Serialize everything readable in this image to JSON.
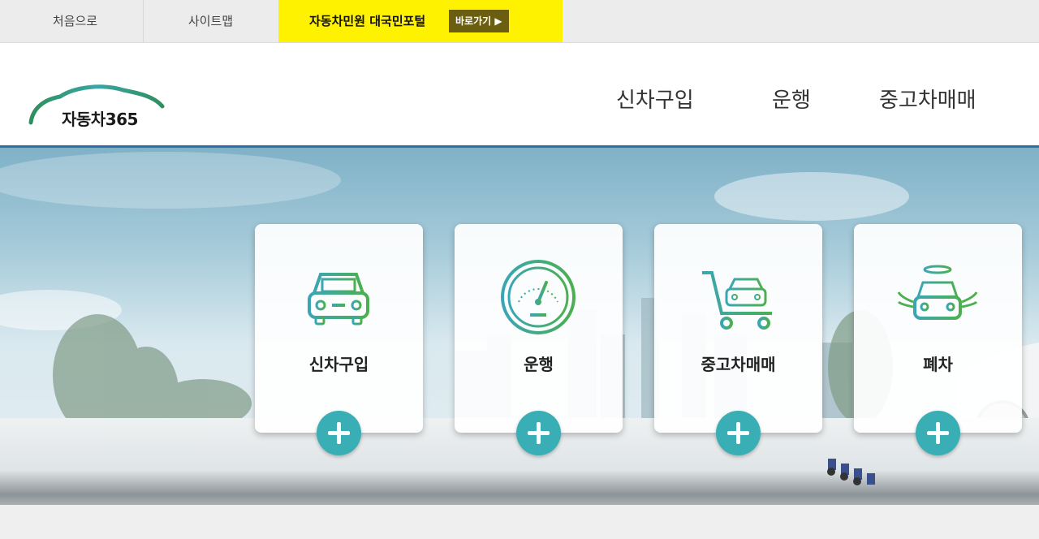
{
  "topbar": {
    "home_label": "처음으로",
    "sitemap_label": "사이트맵",
    "portal_label": "자동차민원 대국민포털",
    "portal_go_label": "바로가기 ▶"
  },
  "header": {
    "logo_text": "자동차365",
    "nav": [
      "신차구입",
      "운행",
      "중고차매매"
    ]
  },
  "cards": [
    {
      "label": "신차구입",
      "icon": "new-car-icon"
    },
    {
      "label": "운행",
      "icon": "speedometer-icon"
    },
    {
      "label": "중고차매매",
      "icon": "cart-car-icon"
    },
    {
      "label": "폐차",
      "icon": "angel-car-icon"
    }
  ],
  "colors": {
    "accent_blue": "#2e6ea8",
    "portal_yellow": "#fff200",
    "plus_teal": "#3aaeb5",
    "icon_green": "#4caf50"
  }
}
